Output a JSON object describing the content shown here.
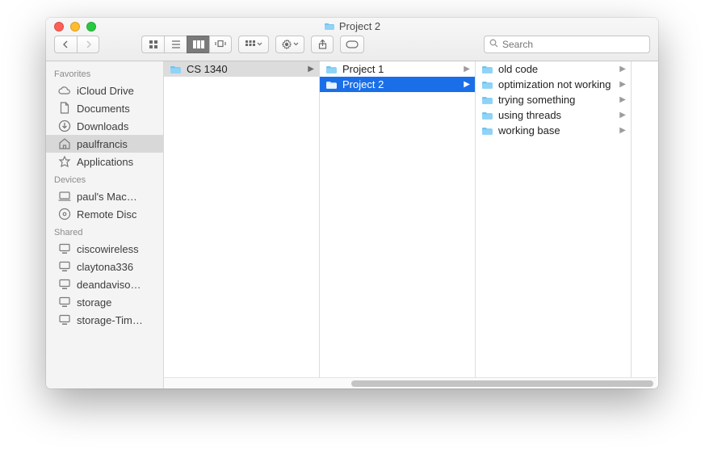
{
  "window": {
    "title": "Project 2"
  },
  "search": {
    "placeholder": "Search"
  },
  "sidebar": {
    "sections": [
      {
        "header": "Favorites",
        "items": [
          {
            "icon": "cloud",
            "label": "iCloud Drive",
            "selected": false
          },
          {
            "icon": "doc",
            "label": "Documents",
            "selected": false
          },
          {
            "icon": "down",
            "label": "Downloads",
            "selected": false
          },
          {
            "icon": "home",
            "label": "paulfrancis",
            "selected": true
          },
          {
            "icon": "app",
            "label": "Applications",
            "selected": false
          }
        ]
      },
      {
        "header": "Devices",
        "items": [
          {
            "icon": "mac",
            "label": "paul's Mac…",
            "selected": false
          },
          {
            "icon": "disc",
            "label": "Remote Disc",
            "selected": false
          }
        ]
      },
      {
        "header": "Shared",
        "items": [
          {
            "icon": "srv",
            "label": "ciscowireless",
            "selected": false
          },
          {
            "icon": "srv",
            "label": "claytona336",
            "selected": false
          },
          {
            "icon": "srv",
            "label": "deandaviso…",
            "selected": false
          },
          {
            "icon": "srv",
            "label": "storage",
            "selected": false
          },
          {
            "icon": "srv",
            "label": "storage-Tim…",
            "selected": false
          }
        ]
      }
    ]
  },
  "columns": [
    {
      "items": [
        {
          "label": "CS 1340",
          "state": "open",
          "hasChildren": true
        }
      ]
    },
    {
      "items": [
        {
          "label": "Project 1",
          "state": "normal",
          "hasChildren": true
        },
        {
          "label": "Project 2",
          "state": "selected",
          "hasChildren": true
        }
      ]
    },
    {
      "items": [
        {
          "label": "old code",
          "state": "normal",
          "hasChildren": true
        },
        {
          "label": "optimization not working",
          "state": "normal",
          "hasChildren": true
        },
        {
          "label": "trying something",
          "state": "normal",
          "hasChildren": true
        },
        {
          "label": "using threads",
          "state": "normal",
          "hasChildren": true
        },
        {
          "label": "working base",
          "state": "normal",
          "hasChildren": true
        }
      ]
    }
  ]
}
